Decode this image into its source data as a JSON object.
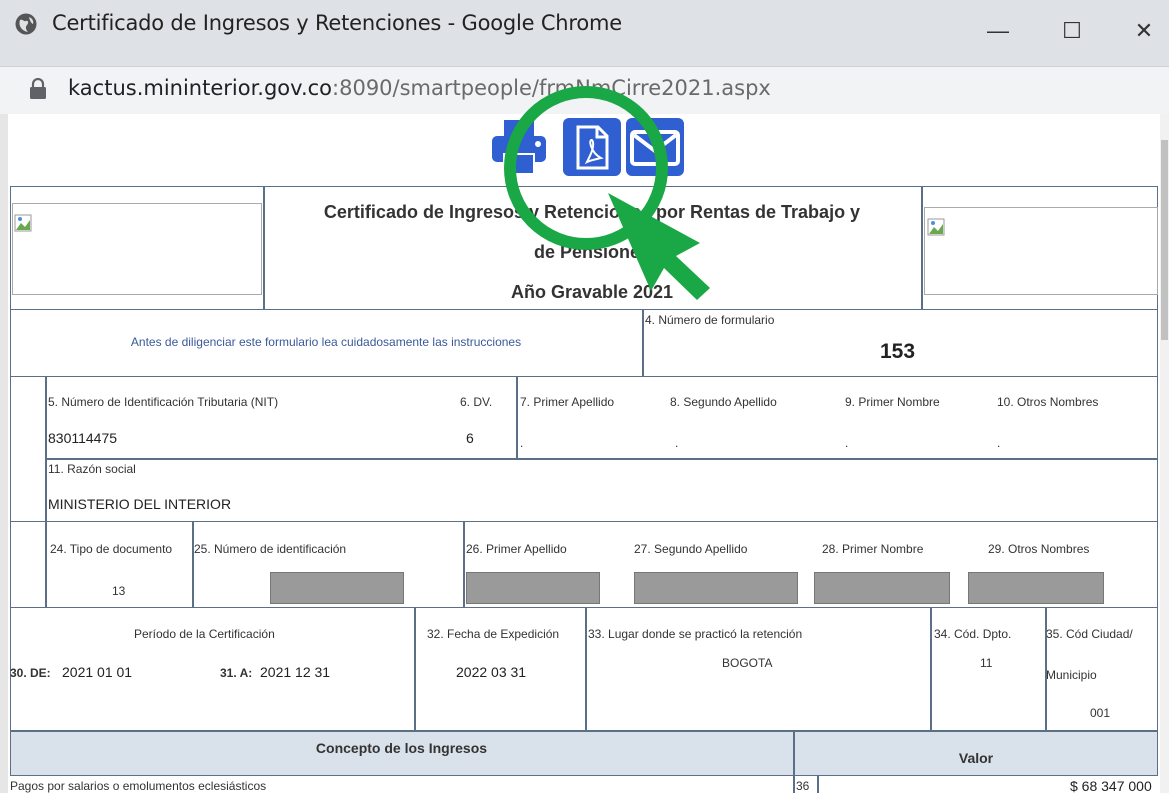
{
  "window": {
    "title": "Certificado de Ingresos y Retenciones - Google Chrome",
    "minimize_glyph": "—",
    "maximize_glyph": "☐",
    "close_glyph": "✕"
  },
  "address": {
    "domain": "kactus.mininterior.gov.co",
    "path": ":8090/smartpeople/frmNmCirre2021.aspx"
  },
  "actions": [
    "print-icon",
    "pdf-icon",
    "mail-icon"
  ],
  "form": {
    "title_line1": "Certificado de Ingresos y Retenciones por Rentas de Trabajo y",
    "title_line2": "de Pensiones",
    "title_line3": "Año Gravable 2021",
    "instructions": "Antes de diligenciar este formulario lea cuidadosamente las instrucciones",
    "form_number_label": "4. Número de formulario",
    "form_number": "153",
    "nit_label": "5. Número de Identificación Tributaria (NIT)",
    "dv_label": "6. DV.",
    "ap1_label": "7. Primer Apellido",
    "ap2_label": "8. Segundo Apellido",
    "n1_label": "9. Primer Nombre",
    "n2_label": "10. Otros Nombres",
    "nit": "830114475",
    "dv": "6",
    "dot": ".",
    "razon_label": "11. Razón social",
    "razon": "MINISTERIO DEL INTERIOR",
    "tipo_doc_label": "24. Tipo de documento",
    "num_id_label": "25. Número de identificación",
    "ap1b_label": "26. Primer Apellido",
    "ap2b_label": "27. Segundo Apellido",
    "n1b_label": "28. Primer Nombre",
    "n2b_label": "29. Otros Nombres",
    "tipo_doc": "13",
    "periodo_label": "Período de la Certificación",
    "de_label": "30. DE:",
    "de_value": "2021 01 01",
    "a_label": "31. A:",
    "a_value": "2021 12 31",
    "fecha_label": "32. Fecha de Expedición",
    "fecha_value": "2022 03 31",
    "lugar_label": "33. Lugar donde se practicó la retención",
    "lugar_value": "BOGOTA",
    "dpto_label": "34. Cód. Dpto.",
    "dpto_value": "11",
    "ciudad_label": "35. Cód Ciudad/",
    "ciudad_label2": "Municipio",
    "ciudad_value": "001",
    "concepto_header": "Concepto de los Ingresos",
    "valor_header": "Valor",
    "row1_label": "Pagos por salarios o emolumentos eclesiásticos",
    "row1_num": "36",
    "row1_value": "$ 68 347 000"
  },
  "colors": {
    "titlebar": "#dee1e6",
    "icon_blue": "#2f5fd0",
    "annotation_green": "#1aa745",
    "form_border": "#5b6f86"
  }
}
